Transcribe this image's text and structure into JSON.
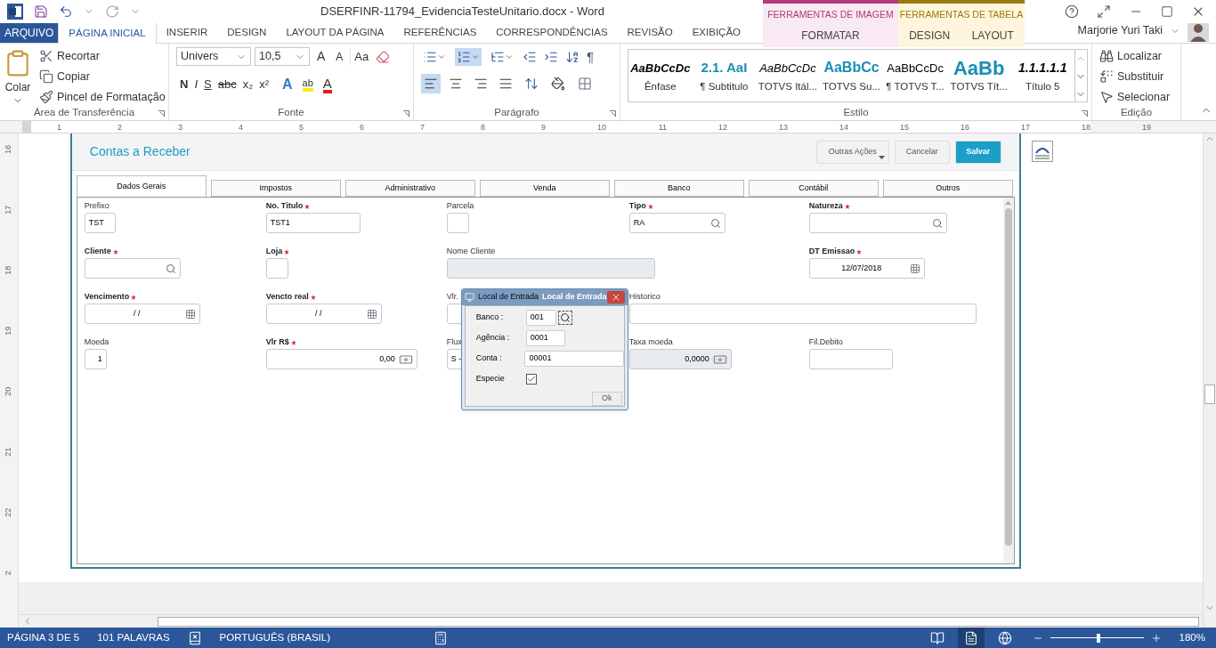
{
  "window": {
    "title": "DSERFINR-11794_EvidenciaTesteUnitario.docx - Word"
  },
  "ribbon_tabs": [
    {
      "label": "ARQUIVO",
      "kind": "file",
      "selected": false
    },
    {
      "label": "PÁGINA INICIAL",
      "kind": "tab",
      "selected": true
    },
    {
      "label": "INSERIR",
      "kind": "tab",
      "selected": false
    },
    {
      "label": "DESIGN",
      "kind": "tab",
      "selected": false
    },
    {
      "label": "LAYOUT DA PÁGINA",
      "kind": "tab",
      "selected": false
    },
    {
      "label": "REFERÊNCIAS",
      "kind": "tab",
      "selected": false
    },
    {
      "label": "CORRESPONDÊNCIAS",
      "kind": "tab",
      "selected": false
    },
    {
      "label": "REVISÃO",
      "kind": "tab",
      "selected": false
    },
    {
      "label": "EXIBIÇÃO",
      "kind": "tab",
      "selected": false
    }
  ],
  "context_groups": [
    {
      "label": "FERRAMENTAS DE IMAGEM",
      "color": "#b03a7a",
      "tabs": [
        {
          "label": "FORMATAR",
          "selected": false
        }
      ]
    },
    {
      "label": "FERRAMENTAS DE TABELA",
      "color": "#9a7a10",
      "tabs": [
        {
          "label": "DESIGN",
          "selected": false
        },
        {
          "label": "LAYOUT",
          "selected": false
        }
      ]
    }
  ],
  "user": {
    "name": "Marjorie Yuri Taki"
  },
  "ribbon": {
    "clipboard": {
      "paste": "Colar",
      "items": [
        "Recortar",
        "Copiar",
        "Pincel de Formatação"
      ],
      "label": "Área de Transferência"
    },
    "font": {
      "name": "Univers",
      "size": "10,5",
      "grow": "A",
      "shrink": "A",
      "case": "Aa",
      "formats": [
        "N",
        "I",
        "S",
        "abc",
        "x₂",
        "x²"
      ],
      "effect_glyph": "A",
      "highlight_glyph": "ab",
      "font_color_glyph": "A",
      "label": "Fonte"
    },
    "paragraph": {
      "lists": [
        {
          "selected": false
        },
        {
          "selected": true
        },
        {
          "selected": false
        }
      ],
      "marks": "¶",
      "alignments": [
        {
          "selected": true
        },
        {
          "selected": false
        },
        {
          "selected": false
        },
        {
          "selected": false
        }
      ],
      "label": "Parágrafo"
    },
    "styles": {
      "items": [
        {
          "preview": "AaBbCcDc",
          "name": "Ênfase",
          "kind": "emphasis"
        },
        {
          "preview": "2.1. AaI",
          "name": "¶ Subtitulo",
          "kind": "subtitle"
        },
        {
          "preview": "AaBbCcDc",
          "name": "TOTVS Itál...",
          "kind": "italic"
        },
        {
          "preview": "AaBbCc",
          "name": "TOTVS Su...",
          "kind": "accent"
        },
        {
          "preview": "AaBbCcDc",
          "name": "¶ TOTVS T...",
          "kind": "plain"
        },
        {
          "preview": "AaBb",
          "name": "TOTVS Tít...",
          "kind": "title"
        },
        {
          "preview": "1.1.1.1.1",
          "name": "Título 5",
          "kind": "numbered"
        }
      ],
      "label": "Estilo"
    },
    "editing": {
      "items": [
        "Localizar",
        "Substituir",
        "Selecionar"
      ],
      "label": "Edição"
    }
  },
  "ruler": {
    "marks": [
      "1",
      "2",
      "3",
      "4",
      "5",
      "6",
      "7",
      "8",
      "9",
      "10",
      "11",
      "12",
      "13",
      "14",
      "15",
      "16",
      "17",
      "18",
      "19"
    ],
    "side_marks": [
      "16",
      "17",
      "18",
      "19",
      "20",
      "21",
      "22",
      "2"
    ]
  },
  "form": {
    "title": "Contas a Receber",
    "actions": [
      {
        "label": "Outras Ações",
        "kind": "menu"
      },
      {
        "label": "Cancelar",
        "kind": "secondary"
      },
      {
        "label": "Salvar",
        "kind": "primary"
      }
    ],
    "tabs": [
      {
        "label": "Dados Gerais",
        "selected": true
      },
      {
        "label": "Impostos",
        "selected": false
      },
      {
        "label": "Administrativo",
        "selected": false
      },
      {
        "label": "Venda",
        "selected": false
      },
      {
        "label": "Banco",
        "selected": false
      },
      {
        "label": "Contábil",
        "selected": false
      },
      {
        "label": "Outros",
        "selected": false
      }
    ],
    "rows": [
      [
        {
          "label": "Prefixo",
          "required": false,
          "kind": "code",
          "value": "TST"
        },
        {
          "label": "No. Titulo",
          "required": true,
          "kind": "text",
          "value": "TST1"
        },
        {
          "label": "Parcela",
          "required": false,
          "kind": "tiny"
        },
        {
          "label": "Tipo",
          "required": true,
          "kind": "lookup",
          "value": "RA"
        },
        {
          "label": "Natureza",
          "required": true,
          "kind": "lookup_wide"
        }
      ],
      [
        {
          "label": "Cliente",
          "required": true,
          "kind": "lookup"
        },
        {
          "label": "Loja",
          "required": true,
          "kind": "tiny"
        },
        {
          "label": "Nome Cliente",
          "required": false,
          "kind": "readonly"
        },
        "",
        {
          "label": "DT Emissao",
          "required": true,
          "kind": "date",
          "value": "12/07/2018"
        }
      ],
      [
        {
          "label": "Vencimento",
          "required": true,
          "kind": "date",
          "value": "/ /"
        },
        {
          "label": "Vencto real",
          "required": true,
          "kind": "date",
          "value": "/ /"
        },
        {
          "label": "Vlr.",
          "required": false,
          "kind": "covered"
        },
        {
          "label": "Historico",
          "required": false,
          "kind": "memo"
        }
      ],
      [
        {
          "label": "Moeda",
          "required": false,
          "kind": "tiny",
          "value": "1"
        },
        {
          "label": "Vlr R$",
          "required": true,
          "kind": "money",
          "value": "0,00"
        },
        {
          "label": "Flux",
          "required": false,
          "kind": "covered",
          "value": "S -"
        },
        {
          "label": "Taxa moeda",
          "required": false,
          "kind": "money_readonly",
          "value": "0,0000"
        },
        {
          "label": "Fil.Debito",
          "required": false,
          "kind": "plain"
        }
      ]
    ]
  },
  "dialog": {
    "title": "Local de Entrada",
    "ghost_title": "Local de Entrada",
    "fields": [
      {
        "label": "Banco :",
        "kind": "lookup",
        "value": "001"
      },
      {
        "label": "Agência :",
        "kind": "short",
        "value": "0001"
      },
      {
        "label": "Conta :",
        "kind": "long",
        "value": "00001"
      },
      {
        "label": "Especie",
        "kind": "checkbox",
        "checked": true
      }
    ],
    "ok": "Ok"
  },
  "status_bar": {
    "page": "PÁGINA 3 DE 5",
    "words": "101 PALAVRAS",
    "language": "PORTUGUÊS (BRASIL)",
    "views": [
      {
        "selected": false
      },
      {
        "selected": true
      },
      {
        "selected": false
      }
    ],
    "zoom": {
      "level": 0.52,
      "reading": "180%"
    }
  }
}
